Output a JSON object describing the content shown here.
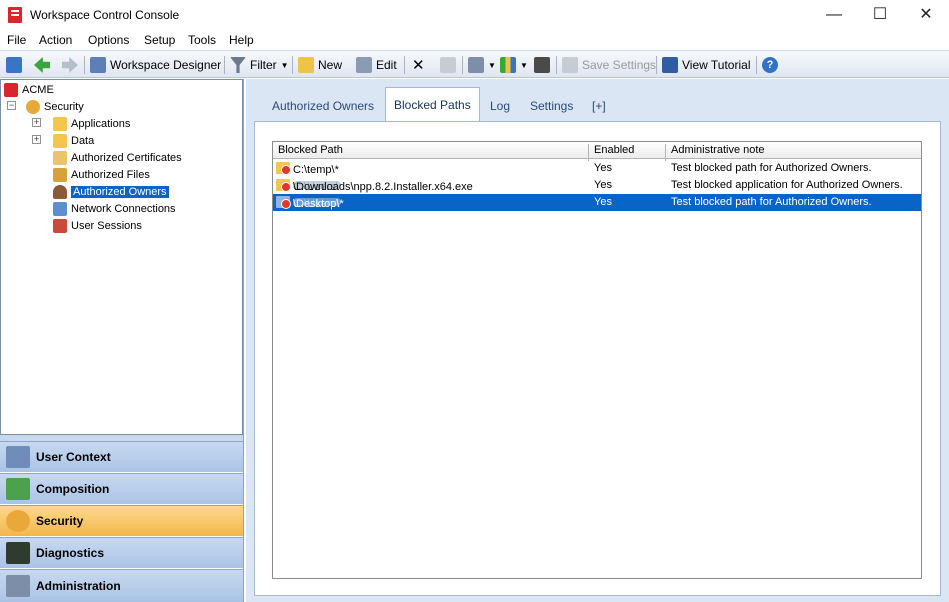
{
  "window": {
    "title": "Workspace Control Console",
    "minimize": "—",
    "maximize": "☐",
    "close": "✕"
  },
  "menu": [
    "File",
    "Action",
    "Options",
    "Setup",
    "Tools",
    "Help"
  ],
  "toolbar": {
    "workspace_designer": "Workspace Designer",
    "filter": "Filter",
    "new": "New",
    "edit": "Edit",
    "save_settings": "Save Settings",
    "view_tutorial": "View Tutorial"
  },
  "tree": {
    "root": "ACME",
    "security": "Security",
    "items": [
      "Applications",
      "Data",
      "Authorized Certificates",
      "Authorized Files",
      "Authorized Owners",
      "Network Connections",
      "User Sessions"
    ],
    "selected": "Authorized Owners"
  },
  "nav": [
    "User Context",
    "Composition",
    "Security",
    "Diagnostics",
    "Administration"
  ],
  "nav_active": "Security",
  "tabs": [
    "Authorized Owners",
    "Blocked Paths",
    "Log",
    "Settings",
    "[+]"
  ],
  "active_tab": "Blocked Paths",
  "grid": {
    "columns": [
      "Blocked Path",
      "Enabled",
      "Administrative note"
    ],
    "rows": [
      {
        "path_a": "C:\\temp\\*",
        "path_b": "",
        "enabled": "Yes",
        "note": "Test blocked path for Authorized Owners."
      },
      {
        "path_a": "C:\\Users\\",
        "path_b": "\\Downloads\\npp.8.2.Installer.x64.exe",
        "enabled": "Yes",
        "note": "Test blocked application for Authorized Owners."
      },
      {
        "path_a": "C:\\Users\\",
        "path_b": "\\Desktop\\*",
        "enabled": "Yes",
        "note": "Test blocked path for Authorized Owners."
      }
    ]
  },
  "colors": {
    "accent": "#0a64c8",
    "active_nav": "#f3b64b",
    "pane_bg": "#dbe6f4"
  }
}
